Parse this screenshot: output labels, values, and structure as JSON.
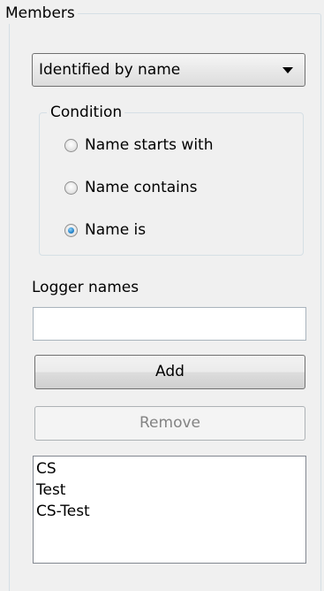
{
  "members": {
    "legend": "Members",
    "filter_dropdown": {
      "selected": "Identified by name"
    },
    "condition": {
      "legend": "Condition",
      "options": [
        {
          "label": "Name starts with",
          "checked": false
        },
        {
          "label": "Name contains",
          "checked": false
        },
        {
          "label": "Name is",
          "checked": true
        }
      ]
    },
    "logger_names": {
      "label": "Logger names",
      "input_value": "",
      "add_label": "Add",
      "remove_label": "Remove",
      "remove_enabled": false,
      "items": [
        "CS",
        "Test",
        "CS-Test"
      ]
    }
  },
  "colors": {
    "group_border": "#d5dfe5",
    "radio_selected": "#2b8bd0",
    "disabled_text": "#838383"
  }
}
